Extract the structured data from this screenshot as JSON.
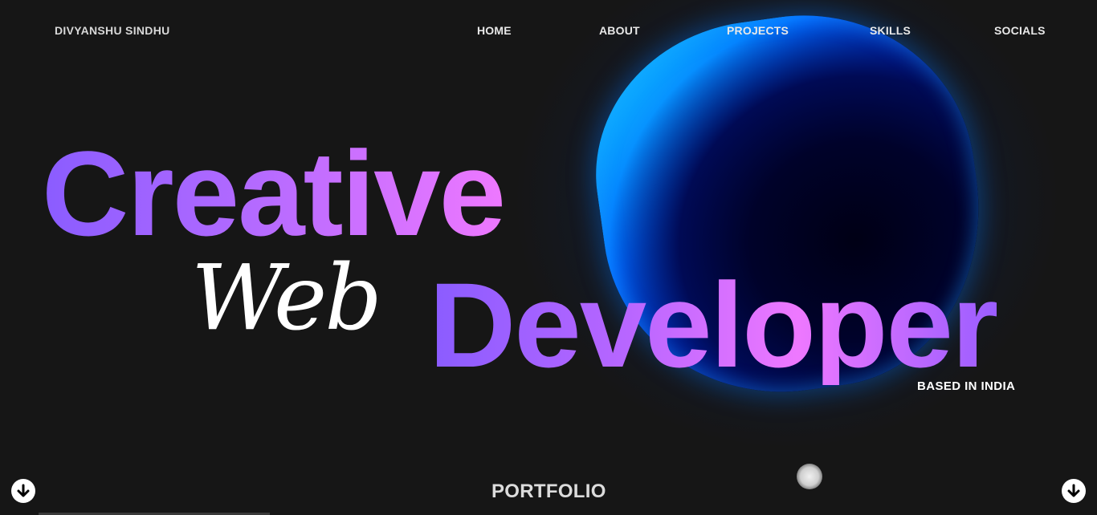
{
  "header": {
    "brand": "DIVYANSHU SINDHU",
    "nav": [
      {
        "label": "HOME"
      },
      {
        "label": "ABOUT"
      },
      {
        "label": "PROJECTS"
      },
      {
        "label": "SKILLS"
      },
      {
        "label": "SOCIALS"
      }
    ]
  },
  "hero": {
    "line1": "Creative",
    "script_word": "Web",
    "line2": "Developer",
    "location": "BASED IN INDIA"
  },
  "footer": {
    "section_label": "PORTFOLIO",
    "left_button_icon": "arrow-down-icon",
    "right_button_icon": "arrow-down-icon"
  },
  "colors": {
    "background": "#161616",
    "gradient_start": "#8a5cff",
    "gradient_end": "#ee78ff",
    "blob_accent": "#0066ff"
  }
}
